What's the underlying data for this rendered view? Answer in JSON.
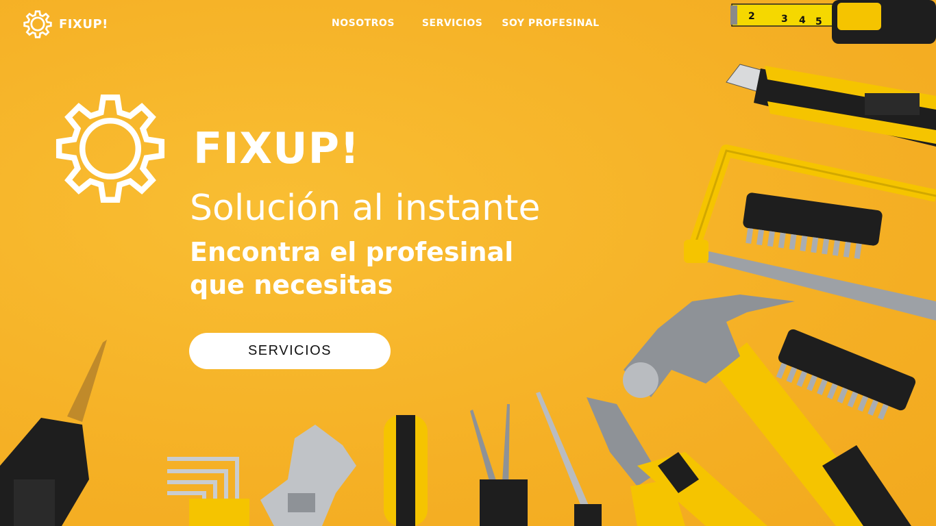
{
  "brand": {
    "name": "FIXUP!",
    "icon": "gear-icon"
  },
  "nav": {
    "links": [
      "NOSOTROS",
      "SERVICIOS",
      "SOY PROFESINAL"
    ]
  },
  "hero": {
    "icon": "gear-icon",
    "title": "FIXUP!",
    "subtitle": "Solución al instante",
    "description_line1": "Encontra el profesinal",
    "description_line2": "que necesitas",
    "cta_label": "SERVICIOS"
  },
  "tape_measure": {
    "numbers": [
      "2",
      "3",
      "4",
      "5"
    ]
  },
  "colors": {
    "background": "#F7B529",
    "text": "#FFFFFF",
    "button_bg": "#FFFFFF",
    "button_text": "#111111",
    "tool_yellow": "#F5C400",
    "tool_black": "#1E1E1E",
    "metal": "#B9BCC0"
  }
}
